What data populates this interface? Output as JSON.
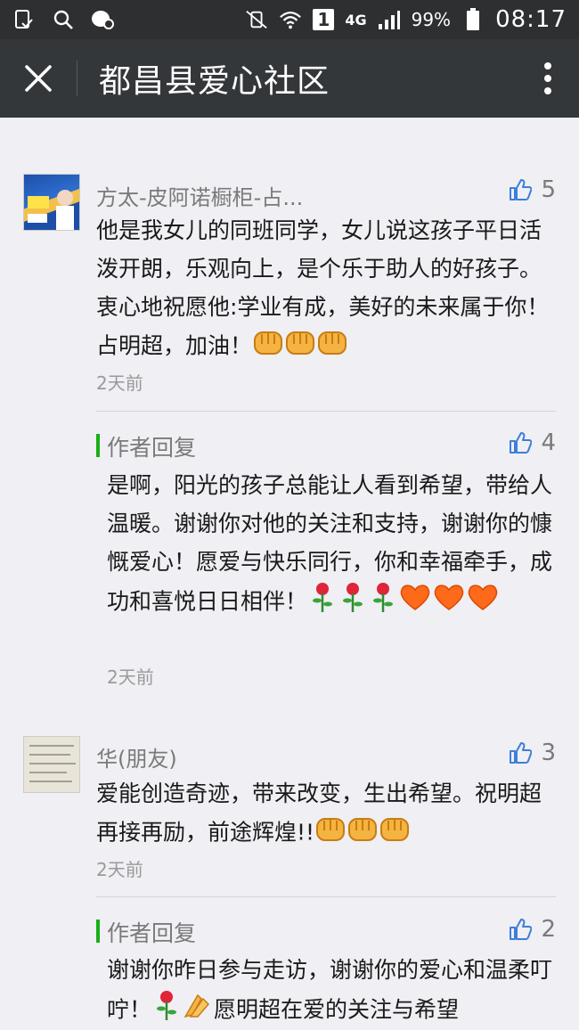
{
  "status_bar": {
    "signal_label": "1",
    "network": "4G",
    "battery": "99%",
    "time": "08:17"
  },
  "header": {
    "title": "都昌县爱心社区"
  },
  "comments": [
    {
      "name": "方太-皮阿诺橱柜-占...",
      "likes": "5",
      "text": "他是我女儿的同班同学，女儿说这孩子平日活泼开朗，乐观向上，是个乐于助人的好孩子。衷心地祝愿他:学业有成，美好的未来属于你！占明超，加油！",
      "time": "2天前",
      "reply": {
        "label": "作者回复",
        "likes": "4",
        "text": "是啊，阳光的孩子总能让人看到希望，带给人温暖。谢谢你对他的关注和支持，谢谢你的慷慨爱心！愿爱与快乐同行，你和幸福牵手，成功和喜悦日日相伴！",
        "time": "2天前"
      }
    },
    {
      "name": "华(朋友)",
      "likes": "3",
      "text": "爱能创造奇迹，带来改变，生出希望。祝明超再接再励，前途辉煌!!",
      "time": "2天前",
      "reply": {
        "label": "作者回复",
        "likes": "2",
        "text_a": "谢谢你昨日参与走访，谢谢你的爱心和温柔叮咛！",
        "text_b": "愿明超在爱的关注与希望"
      }
    }
  ],
  "colors": {
    "status_bar_bg": "#2d2f31",
    "title_bar_bg": "#34373a",
    "page_bg": "#efeff4",
    "reply_accent": "#1aad19"
  }
}
